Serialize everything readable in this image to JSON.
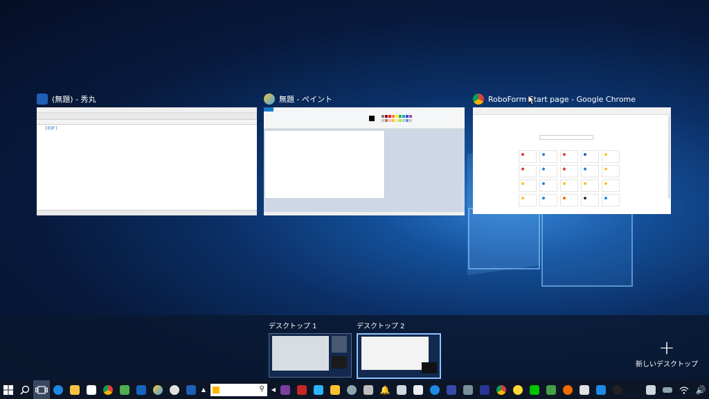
{
  "windows": [
    {
      "title": "(無題) - 秀丸",
      "icon": "hidemaru-icon",
      "eof": "[EOF]"
    },
    {
      "title": "無題 - ペイント",
      "icon": "paint-icon"
    },
    {
      "title": "RoboForm Start page - Google Chrome",
      "icon": "chrome-icon"
    }
  ],
  "desktops": [
    {
      "label": "デスクトップ 1"
    },
    {
      "label": "デスクトップ 2",
      "active": true
    }
  ],
  "new_desktop": {
    "icon": "+",
    "label": "新しいデスクトップ"
  },
  "taskbar": {
    "search_placeholder": "",
    "colors": {
      "bg": "#0d1626",
      "accent": "#1979ca"
    }
  }
}
